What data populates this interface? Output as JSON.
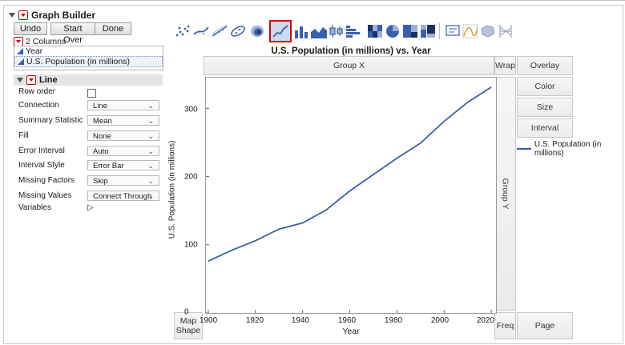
{
  "window": {
    "title": "Graph Builder"
  },
  "toolbar": {
    "undo": "Undo",
    "start_over": "Start Over",
    "done": "Done"
  },
  "columns": {
    "header": "2 Columns",
    "items": [
      "Year",
      "U.S. Population (in millions)"
    ]
  },
  "line_section": {
    "title": "Line"
  },
  "properties": [
    {
      "label": "Row order",
      "kind": "checkbox",
      "value": false
    },
    {
      "label": "Connection",
      "kind": "dropdown",
      "value": "Line"
    },
    {
      "label": "Summary Statistic",
      "kind": "dropdown",
      "value": "Mean"
    },
    {
      "label": "Fill",
      "kind": "dropdown",
      "value": "None"
    },
    {
      "label": "Error Interval",
      "kind": "dropdown",
      "value": "Auto"
    },
    {
      "label": "Interval Style",
      "kind": "dropdown",
      "value": "Error Bar"
    },
    {
      "label": "Missing Factors",
      "kind": "dropdown",
      "value": "Skip"
    },
    {
      "label": "Missing Values",
      "kind": "dropdown",
      "value": "Connect Through"
    },
    {
      "label": "Variables",
      "kind": "expander"
    }
  ],
  "drop_zones": {
    "group_x": "Group X",
    "group_y": "Group Y",
    "wrap": "Wrap",
    "overlay": "Overlay",
    "color": "Color",
    "size": "Size",
    "interval": "Interval",
    "map_shape_1": "Map",
    "map_shape_2": "Shape",
    "freq": "Freq",
    "page": "Page"
  },
  "element_icons": [
    "points-icon",
    "smoother-icon",
    "line-of-fit-icon",
    "ellipse-icon",
    "contour-icon",
    "line-icon",
    "bar-icon",
    "area-icon",
    "box-plot-icon",
    "histogram-icon",
    "heatmap-icon",
    "pie-icon",
    "treemap-icon",
    "mosaic-icon",
    "caption-box-icon",
    "formula-icon",
    "map-shapes-icon",
    "parallel-icon"
  ],
  "selected_icon": "line-icon",
  "accent": {
    "selected_border": "#e00000",
    "line": "#3a5fae"
  },
  "chart_data": {
    "type": "line",
    "title": "U.S. Population (in millions) vs. Year",
    "xlabel": "Year",
    "ylabel": "U.S. Population (in millions)",
    "x": [
      1900,
      1910,
      1920,
      1930,
      1940,
      1950,
      1960,
      1970,
      1980,
      1990,
      2000,
      2010,
      2020
    ],
    "series": [
      {
        "name": "U.S. Population (in millions)",
        "values": [
          76,
          92,
          106,
          123,
          132,
          151,
          179,
          203,
          227,
          249,
          281,
          309,
          331
        ]
      }
    ],
    "xlim": [
      1899,
      2022
    ],
    "ylim": [
      0,
      345
    ],
    "xticks": [
      1900,
      1920,
      1940,
      1960,
      1980,
      2000,
      2020
    ],
    "yticks": [
      0,
      100,
      200,
      300
    ],
    "legend_position": "right"
  }
}
